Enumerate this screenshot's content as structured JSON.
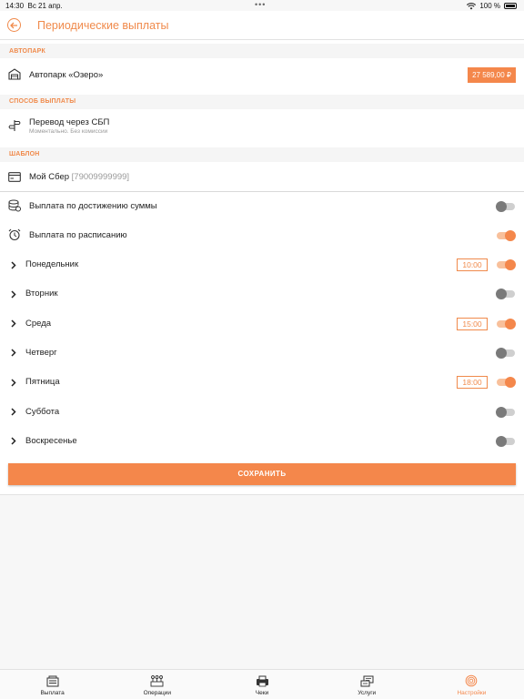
{
  "status_bar": {
    "time": "14:30",
    "date": "Вс 21 апр.",
    "battery": "100 %"
  },
  "header": {
    "title": "Периодические выплаты"
  },
  "fleet": {
    "section_label": "АВТОПАРК",
    "name": "Автопарк «Озеро»",
    "amount": "27 589,00 ₽"
  },
  "payment_method": {
    "section_label": "СПОСОБ ВЫПЛАТЫ",
    "name": "Перевод через СБП",
    "description": "Моментально. Без комиссии"
  },
  "template": {
    "section_label": "ШАБЛОН",
    "name": "Мой Сбер",
    "number": "[79009999999]"
  },
  "by_amount": {
    "label": "Выплата по достижению суммы",
    "enabled": false
  },
  "by_schedule": {
    "label": "Выплата по расписанию",
    "enabled": true
  },
  "days": [
    {
      "label": "Понедельник",
      "time": "10:00",
      "enabled": true
    },
    {
      "label": "Вторник",
      "time": "",
      "enabled": false
    },
    {
      "label": "Среда",
      "time": "15:00",
      "enabled": true
    },
    {
      "label": "Четверг",
      "time": "",
      "enabled": false
    },
    {
      "label": "Пятница",
      "time": "18:00",
      "enabled": true
    },
    {
      "label": "Суббота",
      "time": "",
      "enabled": false
    },
    {
      "label": "Воскресенье",
      "time": "",
      "enabled": false
    }
  ],
  "save_label": "СОХРАНИТЬ",
  "tabs": [
    {
      "label": "Выплата",
      "icon": "payout-icon",
      "active": false
    },
    {
      "label": "Операции",
      "icon": "operations-icon",
      "active": false
    },
    {
      "label": "Чеки",
      "icon": "receipts-icon",
      "active": false
    },
    {
      "label": "Услуги",
      "icon": "services-icon",
      "active": false
    },
    {
      "label": "Настройки",
      "icon": "settings-icon",
      "active": true
    }
  ],
  "colors": {
    "accent": "#f4874b",
    "accent_light": "#f8c09b",
    "toggle_off": "#7a7a7a"
  }
}
